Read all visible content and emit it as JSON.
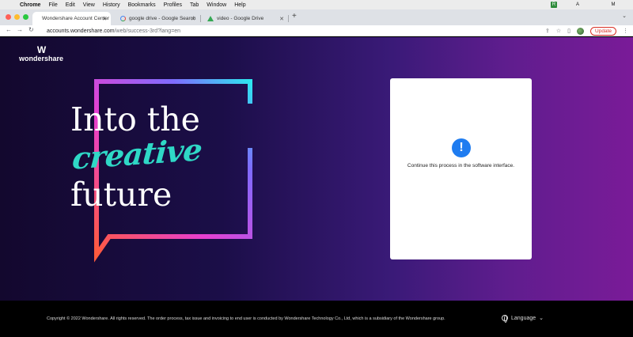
{
  "menubar": {
    "app": "Chrome",
    "items": [
      "File",
      "Edit",
      "View",
      "History",
      "Bookmarks",
      "Profiles",
      "Tab",
      "Window",
      "Help"
    ],
    "status_letter": "M"
  },
  "tabs": [
    {
      "label": "Wondershare Account Center",
      "favicon": "wondershare-icon",
      "active": true
    },
    {
      "label": "google drive - Google Search",
      "favicon": "google-icon",
      "active": false
    },
    {
      "label": "video - Google Drive",
      "favicon": "google-drive-icon",
      "active": false
    }
  ],
  "toolbar": {
    "url_host": "accounts.wondershare.com",
    "url_path": "/web/success-3rd?lang=en",
    "update_label": "Update"
  },
  "page": {
    "logo_text": "wondershare",
    "hero": {
      "line1": "Into the",
      "line2": "creative",
      "line3": "future"
    },
    "card_message": "Continue this process in the software interface."
  },
  "footer": {
    "copyright": "Copyright © 2022 Wondershare. All rights reserved. The order process, tax issue and invoicing to end user is conducted by Wondershare Technology Co., Ltd, which is a subsidiary of the Wondershare group.",
    "language_label": "Language"
  },
  "colors": {
    "accent_teal": "#2fd8c6",
    "info_blue": "#1f7cf0",
    "update_red": "#d93025"
  }
}
